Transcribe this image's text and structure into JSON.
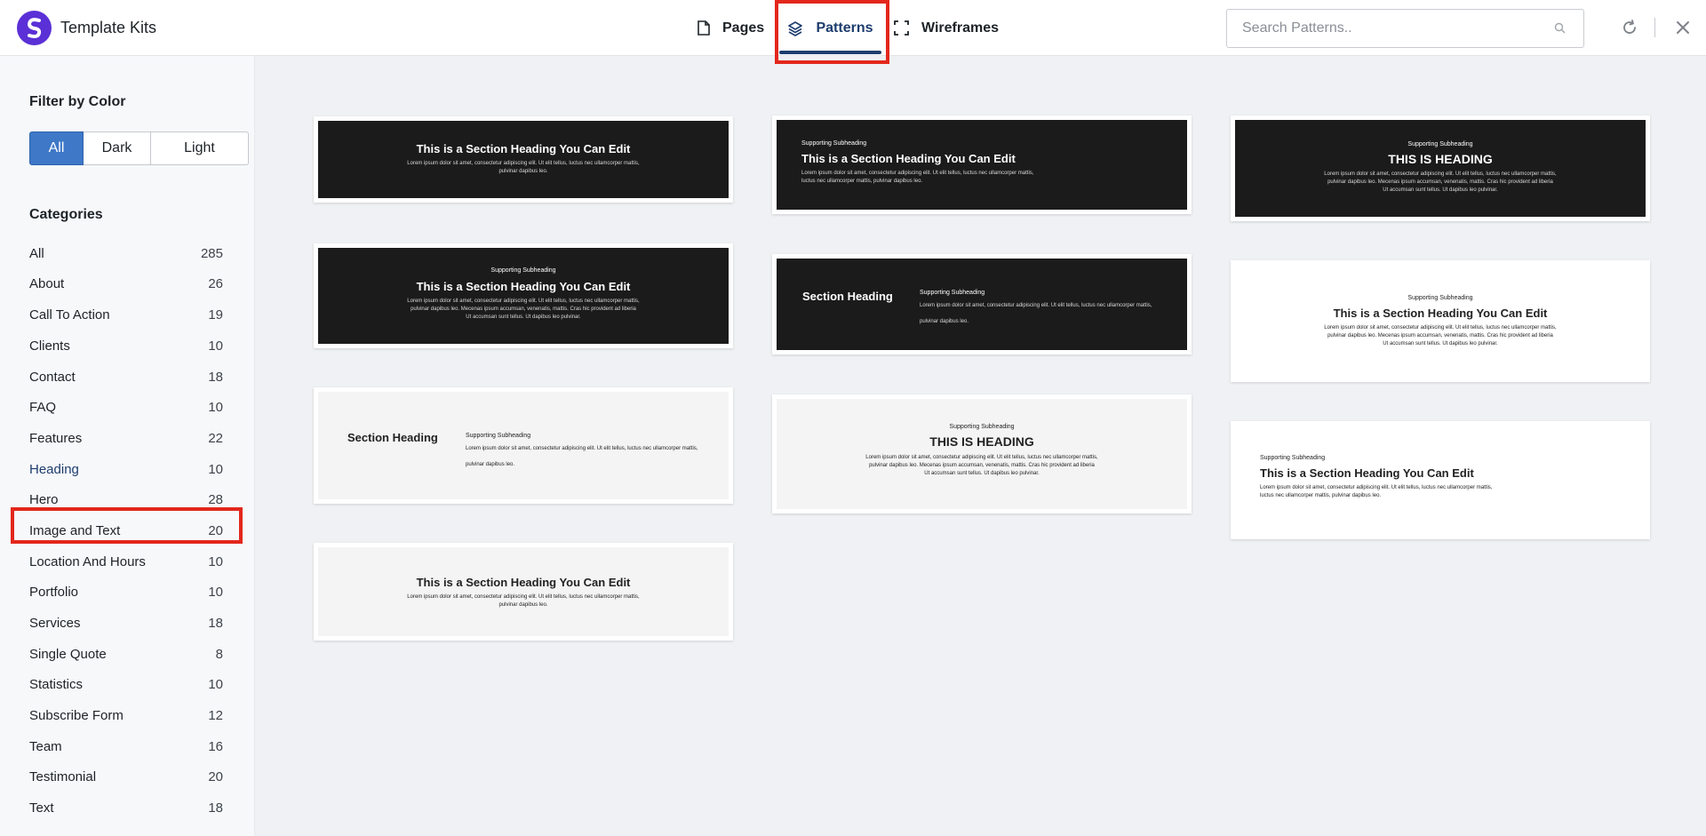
{
  "header": {
    "app_title": "Template Kits",
    "tabs": [
      {
        "label": "Pages",
        "icon": "file-icon"
      },
      {
        "label": "Patterns",
        "icon": "layers-icon",
        "active": true
      },
      {
        "label": "Wireframes",
        "icon": "frame-icon"
      }
    ],
    "search_placeholder": "Search Patterns.."
  },
  "sidebar": {
    "filter_title": "Filter by Color",
    "filters": [
      "All",
      "Dark",
      "Light"
    ],
    "active_filter": "All",
    "categories_title": "Categories",
    "categories": [
      {
        "label": "All",
        "count": "285"
      },
      {
        "label": "About",
        "count": "26"
      },
      {
        "label": "Call To Action",
        "count": "19"
      },
      {
        "label": "Clients",
        "count": "10"
      },
      {
        "label": "Contact",
        "count": "18"
      },
      {
        "label": "FAQ",
        "count": "10"
      },
      {
        "label": "Features",
        "count": "22"
      },
      {
        "label": "Heading",
        "count": "10"
      },
      {
        "label": "Hero",
        "count": "28"
      },
      {
        "label": "Image and Text",
        "count": "20"
      },
      {
        "label": "Location And Hours",
        "count": "10"
      },
      {
        "label": "Portfolio",
        "count": "10"
      },
      {
        "label": "Services",
        "count": "18"
      },
      {
        "label": "Single Quote",
        "count": "8"
      },
      {
        "label": "Statistics",
        "count": "10"
      },
      {
        "label": "Subscribe Form",
        "count": "12"
      },
      {
        "label": "Team",
        "count": "16"
      },
      {
        "label": "Testimonial",
        "count": "20"
      },
      {
        "label": "Text",
        "count": "18"
      }
    ],
    "active_category": "Heading"
  },
  "patterns": {
    "heading_edit": "This is a Section Heading You Can Edit",
    "heading_caps": "THIS IS HEADING",
    "section_heading": "Section Heading",
    "supporting": "Supporting Subheading",
    "lorem_1": "Lorem ipsum dolor sit amet, consectetur adipiscing elit. Ut elit tellus, luctus nec ullamcorper mattis,",
    "lorem_2": "pulvinar dapibus leo.",
    "lorem_3": "pulvinar dapibus leo. Mecenas ipsum accumsan, venenatis, mattis. Cras hic provident ad liberia",
    "lorem_4": "Ut accumsan sunt tellus. Ut dapibus leo pulvinar.",
    "lorem_5": "luctus nec ullamcorper mattis, pulvinar dapibus leo."
  },
  "colors": {
    "accent": "#1d3d6e",
    "brand": "#5b30d6",
    "highlight": "#e3271c",
    "button_active": "#3e78c7"
  }
}
